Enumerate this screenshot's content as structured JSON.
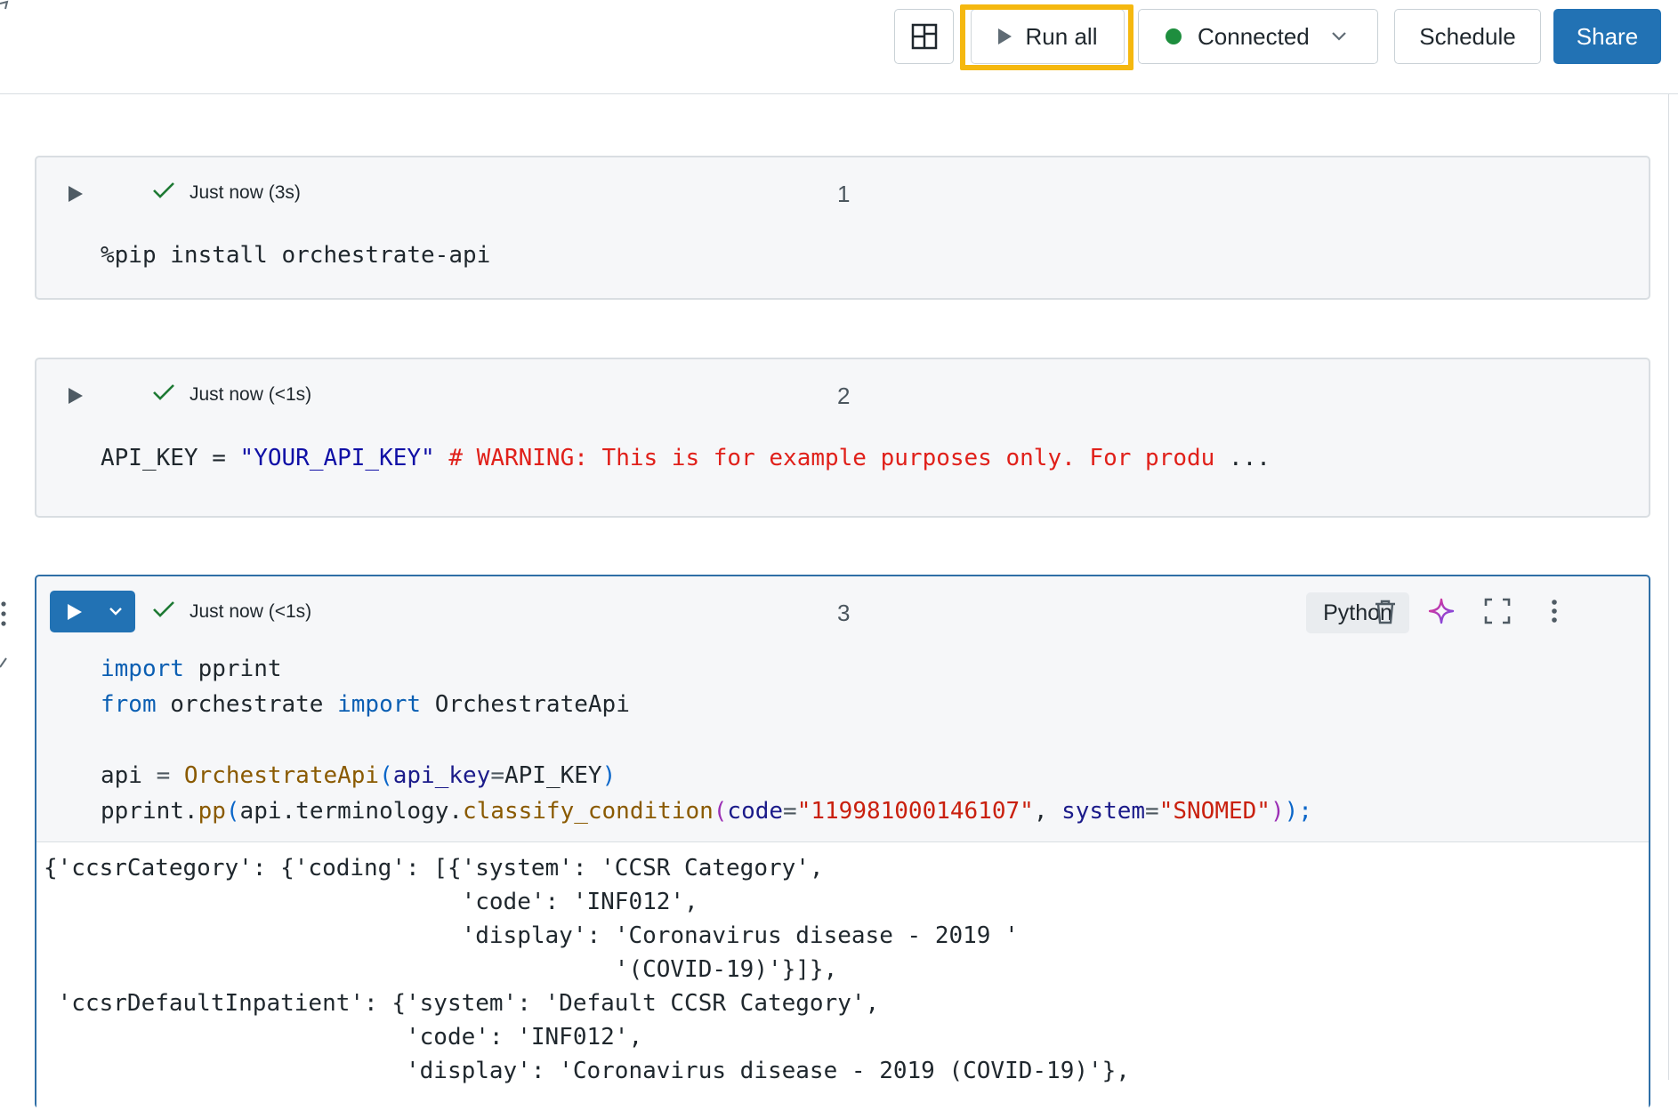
{
  "toolbar": {
    "layout_icon": "layout-grid-icon",
    "run_all_label": "Run all",
    "connected_label": "Connected",
    "status_color": "#1e8e3e",
    "schedule_label": "Schedule",
    "share_label": "Share",
    "accent_color": "#2272b4",
    "highlight_color": "#f5b80f"
  },
  "cells": [
    {
      "number": "1",
      "status": "Just now (3s)",
      "code": "%pip install orchestrate-api"
    },
    {
      "number": "2",
      "status": "Just now (<1s)",
      "code_var": "API_KEY",
      "code_eq": " = ",
      "code_str": "\"YOUR_API_KEY\"",
      "code_comment": " # WARNING: This is for example purposes only. For produ",
      "code_ellipsis": " ..."
    },
    {
      "number": "3",
      "status": "Just now (<1s)",
      "language": "Python",
      "code_lines": {
        "l1_kw": "import",
        "l1_rest": " pprint",
        "l2_kw": "from",
        "l2_mid": " orchestrate ",
        "l2_kw2": "import",
        "l2_rest": " OrchestrateApi",
        "l4_a": "api ",
        "l4_eq": "=",
        "l4_fn": " OrchestrateApi",
        "l4_p1": "(",
        "l4_arg": "api_key",
        "l4_eq2": "=",
        "l4_val": "API_KEY",
        "l4_p2": ")",
        "l5_a": "pprint.",
        "l5_fn": "pp",
        "l5_p1": "(",
        "l5_b": "api.terminology.",
        "l5_fn2": "classify_condition",
        "l5_p2": "(",
        "l5_arg1": "code",
        "l5_eq1": "=",
        "l5_str1": "\"119981000146107\"",
        "l5_comma": ", ",
        "l5_arg2": "system",
        "l5_eq2": "=",
        "l5_str2": "\"SNOMED\"",
        "l5_p3": ")",
        "l5_p4": ");"
      },
      "output": "{'ccsrCategory': {'coding': [{'system': 'CCSR Category',\n                              'code': 'INF012',\n                              'display': 'Coronavirus disease - 2019 '\n                                         '(COVID-19)'}]},\n 'ccsrDefaultInpatient': {'system': 'Default CCSR Category',\n                          'code': 'INF012',\n                          'display': 'Coronavirus disease - 2019 (COVID-19)'},"
    }
  ]
}
